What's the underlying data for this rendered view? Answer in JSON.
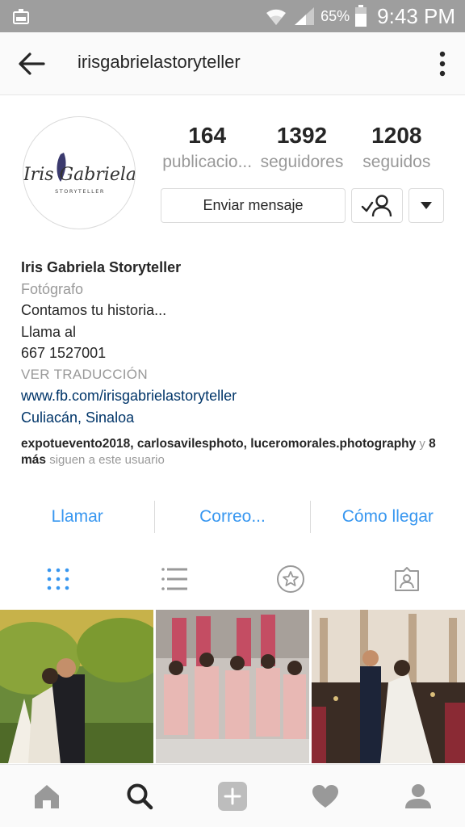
{
  "status_bar": {
    "battery_percent": "65%",
    "time": "9:43 PM"
  },
  "header": {
    "username": "irisgabrielastoryteller"
  },
  "profile": {
    "avatar_logo_text": "Iris Gabriela",
    "avatar_logo_subtext": "STORYTELLER",
    "stats": [
      {
        "value": "164",
        "label": "publicacio..."
      },
      {
        "value": "1392",
        "label": "seguidores"
      },
      {
        "value": "1208",
        "label": "seguidos"
      }
    ],
    "message_button": "Enviar mensaje"
  },
  "bio": {
    "name": "Iris Gabriela Storyteller",
    "category": "Fotógrafo",
    "lines": [
      "Contamos tu historia...",
      "Llama al",
      "667 1527001"
    ],
    "translate": "VER TRADUCCIÓN",
    "website": "www.fb.com/irisgabrielastoryteller",
    "location": "Culiacán, Sinaloa",
    "followed_by_names": "expotuevento2018, carlosavilesphoto, luceromorales.photography",
    "followed_by_and": " y ",
    "followed_by_more": "8 más",
    "followed_by_suffix": " siguen a este usuario"
  },
  "actions": {
    "call": "Llamar",
    "email": "Correo...",
    "directions": "Cómo llegar"
  },
  "colors": {
    "accent_blue": "#3897f0",
    "link_blue": "#003569",
    "muted_gray": "#999999",
    "status_bar": "#9e9e9e"
  },
  "icons": {
    "tabs": [
      "grid-icon",
      "list-icon",
      "saved-star-icon",
      "tagged-icon"
    ],
    "bottom_nav": [
      "home-icon",
      "search-icon",
      "add-icon",
      "heart-icon",
      "profile-icon"
    ]
  }
}
